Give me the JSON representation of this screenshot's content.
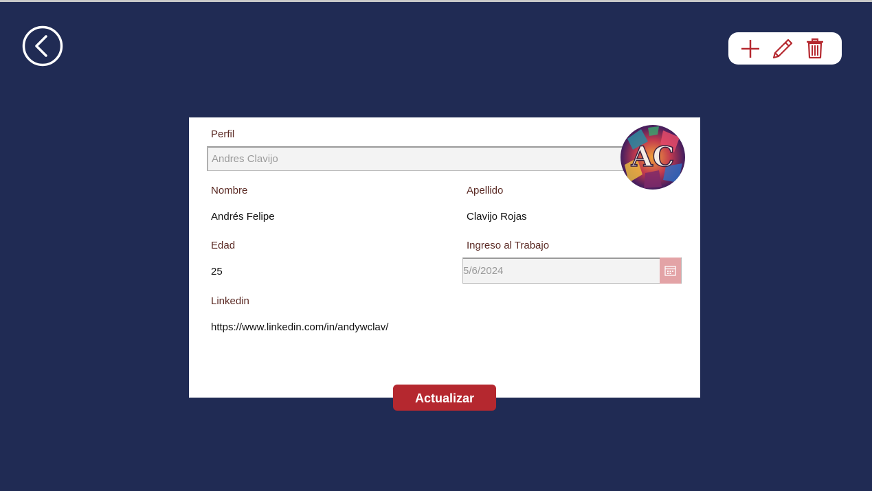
{
  "header": {
    "back_icon": "chevron-left-circle-icon",
    "toolbar": {
      "add_icon": "plus-icon",
      "edit_icon": "pencil-icon",
      "delete_icon": "trash-icon"
    }
  },
  "form": {
    "profile": {
      "label": "Perfil",
      "value": "Andres Clavijo"
    },
    "avatar": {
      "initials": "AC"
    },
    "first_name": {
      "label": "Nombre",
      "value": "Andrés Felipe"
    },
    "last_name": {
      "label": "Apellido",
      "value": "Clavijo Rojas"
    },
    "age": {
      "label": "Edad",
      "value": "25"
    },
    "hire_date": {
      "label": "Ingreso al Trabajo",
      "value": "5/6/2024",
      "calendar_icon": "calendar-icon"
    },
    "linkedin": {
      "label": "Linkedin",
      "value": "https://www.linkedin.com/in/andywclav/"
    }
  },
  "actions": {
    "update_label": "Actualizar"
  },
  "colors": {
    "background": "#202b54",
    "accent": "#b5282f",
    "label_text": "#5b2a24",
    "calendar_button": "#e3a3a6"
  }
}
